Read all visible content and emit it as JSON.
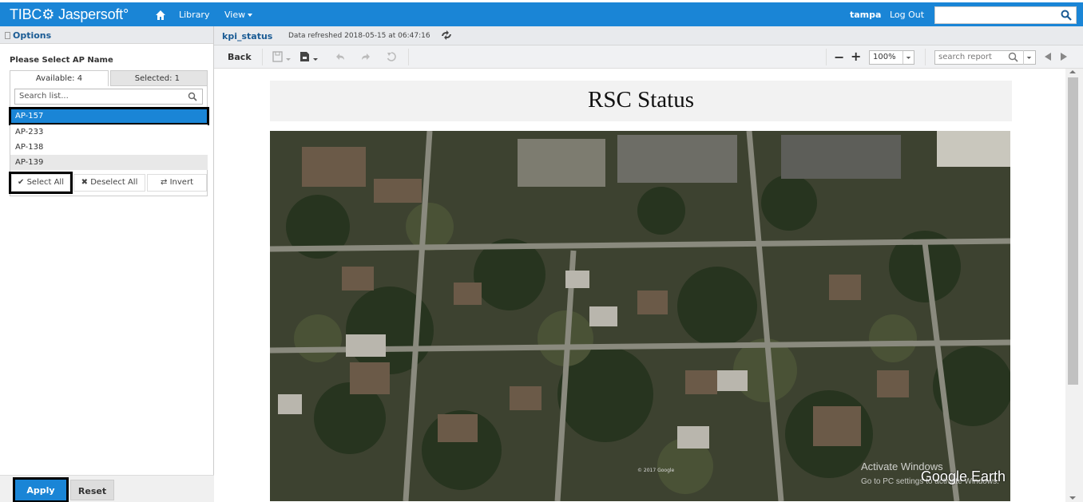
{
  "topbar": {
    "logo": "TIBC⚙ Jaspersoft°",
    "nav": {
      "library": "Library",
      "view": "View"
    },
    "user": "tampa",
    "logout": "Log Out",
    "search_value": ""
  },
  "left_panel": {
    "header": "Options",
    "filter_label": "Please Select AP Name",
    "tabs": {
      "available": "Available: 4",
      "selected": "Selected: 1"
    },
    "search_placeholder": "Search list...",
    "items": [
      "AP-157",
      "AP-233",
      "AP-138",
      "AP-139"
    ],
    "selected_item": "AP-157",
    "actions": {
      "select_all": "Select All",
      "deselect_all": "Deselect All",
      "invert": "Invert"
    },
    "apply": "Apply",
    "reset": "Reset"
  },
  "report": {
    "name": "kpi_status",
    "refreshed": "Data refreshed 2018-05-15 at 06:47:16",
    "back": "Back",
    "zoom": "100%",
    "search_placeholder": "search report",
    "title": "RSC Status",
    "map_brand": "Google Earth",
    "map_copyright": "© 2017 Google",
    "watermark_line1": "Activate Windows",
    "watermark_line2": "Go to PC settings to activate Windows."
  },
  "colors": {
    "brand_blue": "#1a85d6",
    "header_text_blue": "#1a5b94",
    "panel_gray": "#e8eaed"
  }
}
